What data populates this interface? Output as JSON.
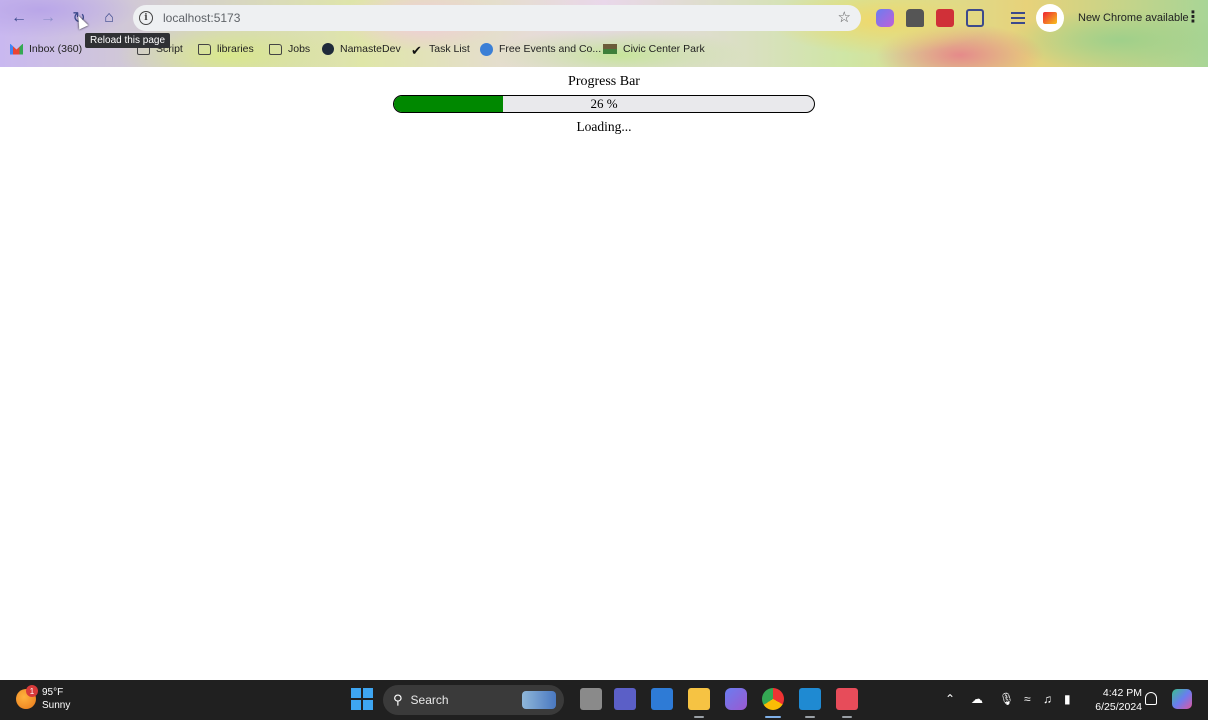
{
  "browser": {
    "url": "localhost:5173",
    "tooltip": "Reload this page",
    "update_label": "New Chrome available",
    "bookmarks": [
      {
        "label": "Inbox (360)",
        "icon": "gmail-icon"
      },
      {
        "label": "Script",
        "icon": "folder-icon"
      },
      {
        "label": "libraries",
        "icon": "folder-icon"
      },
      {
        "label": "Jobs",
        "icon": "folder-icon"
      },
      {
        "label": "NamasteDev",
        "icon": "namastedev-icon"
      },
      {
        "label": "Task List",
        "icon": "checkmark-icon"
      },
      {
        "label": "Free Events and Co...",
        "icon": "events-icon"
      },
      {
        "label": "Civic Center Park",
        "icon": "park-icon"
      }
    ]
  },
  "page": {
    "title": "Progress Bar",
    "progress_label": "26 %",
    "progress_value": 0.26,
    "progress_color": "#008800",
    "status": "Loading..."
  },
  "taskbar": {
    "weather_temp": "95°F",
    "weather_desc": "Sunny",
    "weather_badge": "1",
    "search_label": "Search",
    "time": "4:42 PM",
    "date": "6/25/2024"
  }
}
